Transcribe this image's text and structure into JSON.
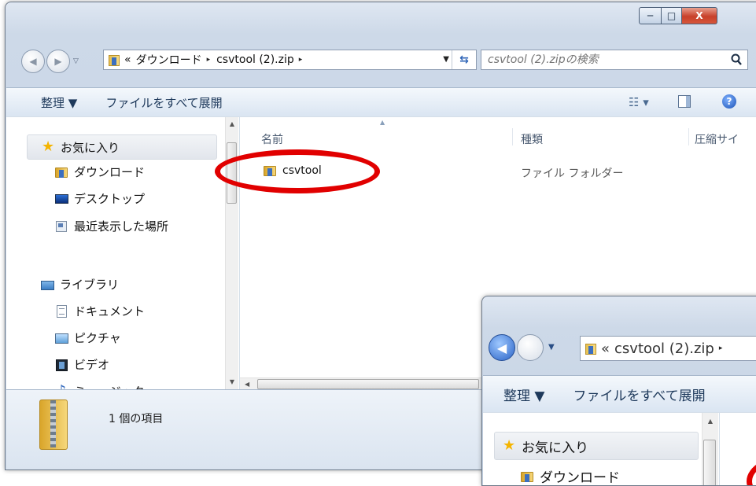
{
  "window": {
    "caption": {
      "minimize": "─",
      "maximize": "□",
      "close": "X"
    }
  },
  "nav": {
    "back_glyph": "◀",
    "forward_glyph": "▶",
    "address": {
      "overflow": "«",
      "segments": [
        "ダウンロード",
        "csvtool (2).zip"
      ],
      "separator": "▸"
    },
    "search_placeholder": "csvtool (2).zipの検索"
  },
  "toolbar": {
    "organize": "整理 ▼",
    "extract_all": "ファイルをすべて展開",
    "view_glyph": "☷ ▾",
    "help_glyph": "?"
  },
  "sidebar": {
    "favorites": "お気に入り",
    "items_fav": [
      "ダウンロード",
      "デスクトップ",
      "最近表示した場所"
    ],
    "library": "ライブラリ",
    "items_lib": [
      "ドキュメント",
      "ピクチャ",
      "ビデオ",
      "ミュージック"
    ]
  },
  "columns": {
    "name": "名前",
    "type": "種類",
    "size": "圧縮サイ"
  },
  "files": [
    {
      "name": "csvtool",
      "type": "ファイル フォルダー"
    }
  ],
  "status": {
    "count": "1 個の項目"
  },
  "inset": {
    "address": {
      "overflow": "«",
      "segment": "csvtool (2).zip",
      "separator": "▸"
    },
    "toolbar": {
      "organize": "整理 ▼",
      "extract_all": "ファイルをすべて展開"
    },
    "sidebar": {
      "favorites": "お気に入り",
      "downloads": "ダウンロード"
    }
  },
  "colors": {
    "highlight_ring": "#e10000",
    "link_text": "#1e395b"
  }
}
